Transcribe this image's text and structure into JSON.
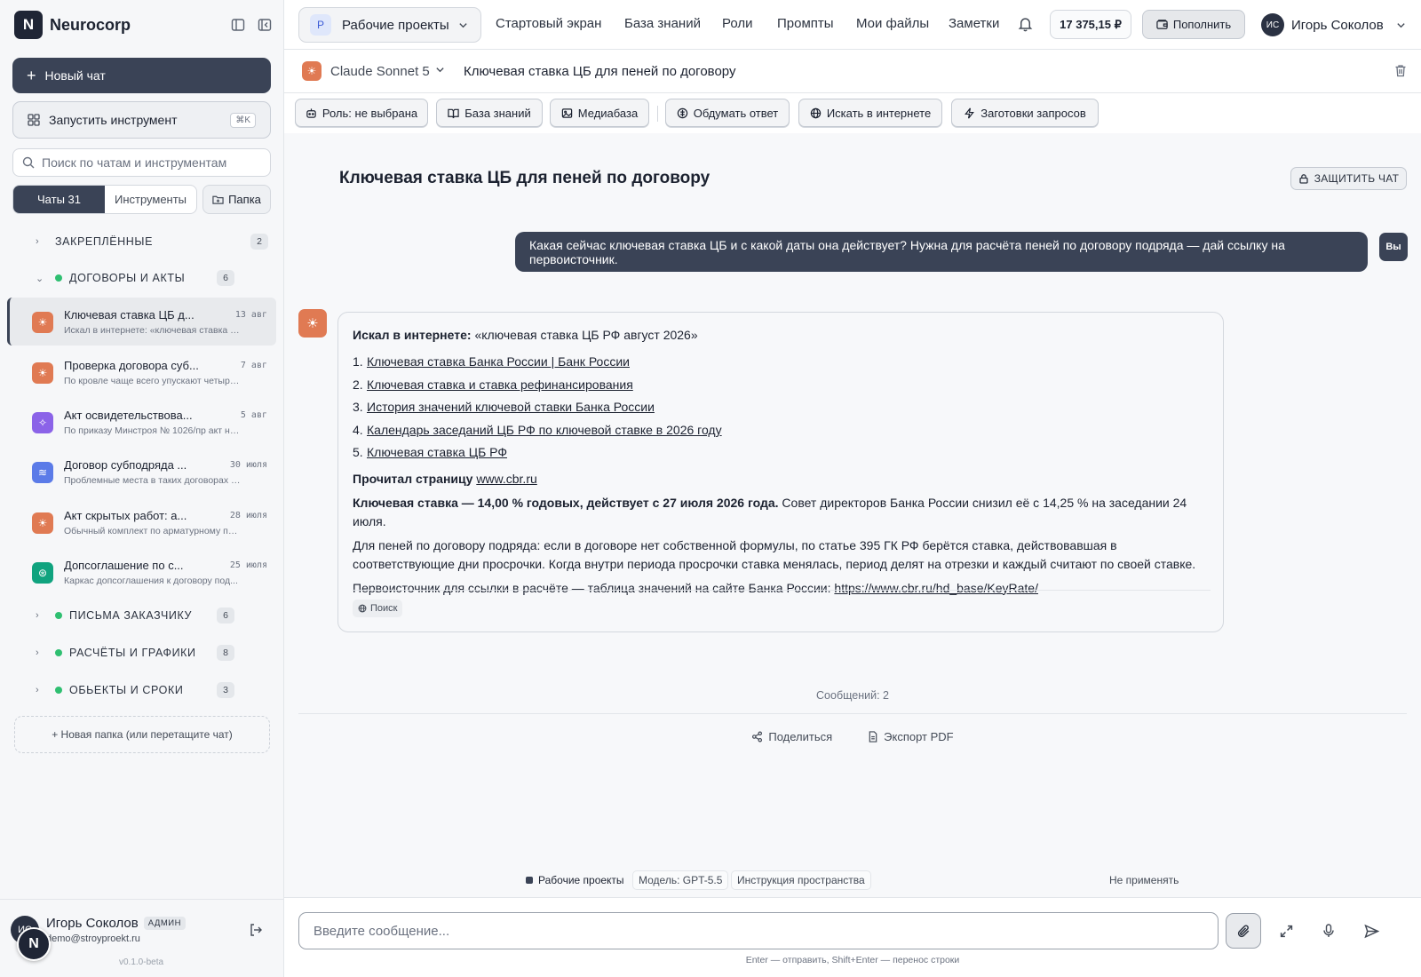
{
  "brand": {
    "logo_letter": "N",
    "name": "Neurocorp"
  },
  "sidebar": {
    "new_chat": "Новый чат",
    "run_tool": "Запустить инструмент",
    "run_tool_kbd": "⌘K",
    "search_placeholder": "Поиск по чатам и инструментам",
    "tabs": {
      "chats": "Чаты 31",
      "tools": "Инструменты"
    },
    "folder_button": "Папка",
    "pinned": {
      "label": "ЗАКРЕПЛЁННЫЕ",
      "count": "2"
    },
    "contracts": {
      "label": "ДОГОВОРЫ И АКТЫ",
      "count": "6"
    },
    "chats": [
      {
        "title": "Ключевая ставка ЦБ д...",
        "date": "13 авг",
        "sub": "Искал в интернете: «ключевая ставка Ц...",
        "icon": "☀",
        "color": "#e07a53"
      },
      {
        "title": "Проверка договора суб...",
        "date": "7 авг",
        "sub": "По кровле чаще всего упускают четыре...",
        "icon": "☀",
        "color": "#e07a53"
      },
      {
        "title": "Акт освидетельствова...",
        "date": "5 авг",
        "sub": "По приказу Минстроя № 1026/пр акт на ...",
        "icon": "✧",
        "color": "#8b63e8"
      },
      {
        "title": "Договор субподряда ...",
        "date": "30 июля",
        "sub": "Проблемные места в таких договорах п...",
        "icon": "≋",
        "color": "#5b7be8"
      },
      {
        "title": "Акт скрытых работ: а...",
        "date": "28 июля",
        "sub": "Обычный комплект по арматурному пр...",
        "icon": "☀",
        "color": "#e07a53"
      },
      {
        "title": "Допсоглашение по с...",
        "date": "25 июля",
        "sub": "Каркас допсоглашения к договору под...",
        "icon": "⊛",
        "color": "#10a37f"
      }
    ],
    "folders": [
      {
        "label": "ПИСЬМА ЗАКАЗЧИКУ",
        "count": "6"
      },
      {
        "label": "РАСЧЁТЫ И ГРАФИКИ",
        "count": "8"
      },
      {
        "label": "ОБЬЕКТЫ И СРОКИ",
        "count": "3"
      }
    ],
    "new_folder": "+ Новая папка (или перетащите чат)",
    "user": {
      "initials": "ИС",
      "name": "Игорь Соколов",
      "role": "АДМИН",
      "email": "demo@stroyproekt.ru"
    },
    "version": "v0.1.0-beta"
  },
  "topbar": {
    "workspace_badge": "P",
    "workspace": "Рабочие проекты",
    "nav": [
      "Стартовый экран",
      "База знаний",
      "Роли",
      "Промпты",
      "Мои файлы",
      "Заметки"
    ],
    "balance": "17 375,15 ₽",
    "topup": "Пополнить",
    "user_initials": "ИС",
    "user_name": "Игорь Соколов"
  },
  "chat_header": {
    "model": "Claude Sonnet 5",
    "title": "Ключевая ставка ЦБ для пеней по договору"
  },
  "toolbar": [
    "Роль: не выбрана",
    "База знаний",
    "Медиабаза",
    "Обдумать ответ",
    "Искать в интернете",
    "Заготовки запросов"
  ],
  "main": {
    "title": "Ключевая ставка ЦБ для пеней по договору",
    "protect": "ЗАЩИТИТЬ ЧАТ",
    "user_message": "Какая сейчас ключевая ставка ЦБ и с какой даты она действует? Нужна для расчёта пеней по договору подряда — дай ссылку на первоисточник.",
    "you_label": "Вы",
    "bot": {
      "searched_label": "Искал в интернете:",
      "searched_query": "«ключевая ставка ЦБ РФ август 2026»",
      "links": [
        "Ключевая ставка Банка России | Банк России",
        "Ключевая ставка и ставка рефинансирования",
        "История значений ключевой ставки Банка России",
        "Календарь заседаний ЦБ РФ по ключевой ставке в 2026 году",
        "Ключевая ставка ЦБ РФ"
      ],
      "read_label": "Прочитал страницу",
      "read_link": "www.cbr.ru",
      "rate_bold": "Ключевая ставка — 14,00 % годовых, действует с 27 июля 2026 года.",
      "rate_rest": " Совет директоров Банка России снизил её с 14,25 % на заседании 24 июля.",
      "para2": "Для пеней по договору подряда: если в договоре нет собственной формулы, по статье 395 ГК РФ берётся ставка, действовавшая в соответствующие дни просрочки. Когда внутри периода просрочки ставка менялась, период делят на отрезки и каждый считают по своей ставке.",
      "para3_text": "Первоисточник для ссылки в расчёте — таблица значений на сайте Банка России: ",
      "para3_link": "https://www.cbr.ru/hd_base/KeyRate/",
      "source_tag": "Поиск"
    },
    "messages_count": "Сообщений: 2",
    "share": "Поделиться",
    "export": "Экспорт PDF",
    "footer": {
      "workspace": "Рабочие проекты",
      "model": "Модель: GPT-5.5",
      "instruction": "Инструкция пространства",
      "not_apply": "Не применять"
    }
  },
  "input": {
    "placeholder": "Введите сообщение...",
    "hint": "Enter — отправить, Shift+Enter — перенос строки"
  }
}
